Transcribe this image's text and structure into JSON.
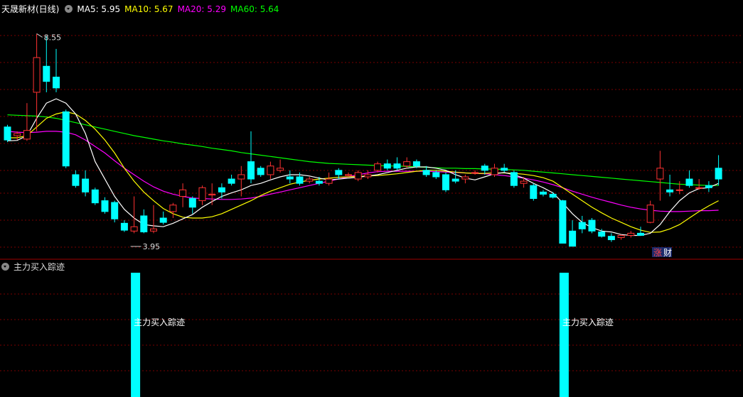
{
  "header": {
    "stock_title": "天晟新材(日线)",
    "ma5": "MA5: 5.95",
    "ma10": "MA10: 5.67",
    "ma20": "MA20: 5.29",
    "ma60": "MA60: 5.64"
  },
  "sub_panel": {
    "title": "主力买入踪迹",
    "bar_label": "主力买入踪迹"
  },
  "badges": {
    "zhang": "涨",
    "cai": "财"
  },
  "colors": {
    "up": "#ff3232",
    "down": "#00ffff",
    "ma5": "#ffffff",
    "ma10": "#ffff00",
    "ma20": "#ff00ff",
    "ma60": "#00ff00",
    "grid": "#7a0000",
    "signal": "#00ffff"
  },
  "chart_data": {
    "type": "candlestick",
    "high_label": "8.55",
    "low_label": "3.95",
    "ylim": [
      3.76,
      9.0
    ],
    "candles": [
      [
        6.4,
        6.45,
        6.05,
        6.1
      ],
      [
        6.2,
        6.3,
        6.1,
        6.25
      ],
      [
        6.12,
        6.95,
        6.08,
        6.32
      ],
      [
        7.2,
        8.55,
        6.3,
        8.0
      ],
      [
        7.8,
        8.5,
        7.2,
        7.45
      ],
      [
        7.55,
        8.2,
        7.2,
        7.3
      ],
      [
        6.75,
        6.8,
        5.45,
        5.5
      ],
      [
        5.3,
        5.4,
        5.0,
        5.05
      ],
      [
        5.2,
        5.4,
        4.8,
        4.9
      ],
      [
        4.95,
        5.0,
        4.6,
        4.65
      ],
      [
        4.7,
        4.78,
        4.4,
        4.45
      ],
      [
        4.66,
        4.7,
        4.2,
        4.28
      ],
      [
        4.18,
        4.25,
        3.98,
        4.02
      ],
      [
        4.0,
        4.8,
        3.95,
        4.1
      ],
      [
        4.35,
        4.5,
        3.95,
        3.98
      ],
      [
        4.0,
        4.6,
        3.95,
        4.05
      ],
      [
        4.3,
        4.45,
        4.15,
        4.2
      ],
      [
        4.45,
        4.65,
        4.3,
        4.6
      ],
      [
        4.8,
        5.1,
        4.55,
        4.95
      ],
      [
        4.75,
        4.8,
        4.4,
        4.55
      ],
      [
        4.7,
        5.05,
        4.6,
        5.0
      ],
      [
        4.83,
        5.1,
        4.6,
        4.85
      ],
      [
        5.0,
        5.1,
        4.75,
        4.9
      ],
      [
        5.2,
        5.3,
        5.05,
        5.1
      ],
      [
        5.2,
        5.5,
        4.8,
        5.3
      ],
      [
        5.6,
        6.3,
        5.1,
        5.2
      ],
      [
        5.45,
        5.5,
        5.25,
        5.3
      ],
      [
        5.3,
        5.6,
        5.2,
        5.5
      ],
      [
        5.4,
        5.65,
        5.35,
        5.45
      ],
      [
        5.25,
        5.4,
        5.1,
        5.2
      ],
      [
        5.25,
        5.35,
        5.05,
        5.1
      ],
      [
        5.15,
        5.25,
        5.1,
        5.2
      ],
      [
        5.15,
        5.25,
        5.05,
        5.1
      ],
      [
        5.1,
        5.35,
        5.05,
        5.2
      ],
      [
        5.4,
        5.45,
        5.2,
        5.3
      ],
      [
        5.3,
        5.35,
        5.25,
        5.3
      ],
      [
        5.2,
        5.4,
        5.15,
        5.35
      ],
      [
        5.25,
        5.4,
        5.2,
        5.3
      ],
      [
        5.4,
        5.6,
        5.35,
        5.55
      ],
      [
        5.55,
        5.65,
        5.4,
        5.45
      ],
      [
        5.55,
        5.7,
        5.4,
        5.45
      ],
      [
        5.5,
        5.7,
        5.45,
        5.6
      ],
      [
        5.6,
        5.65,
        5.45,
        5.5
      ],
      [
        5.4,
        5.5,
        5.25,
        5.3
      ],
      [
        5.35,
        5.4,
        5.2,
        5.25
      ],
      [
        5.3,
        5.35,
        4.9,
        4.95
      ],
      [
        5.2,
        5.4,
        5.1,
        5.15
      ],
      [
        5.2,
        5.3,
        5.1,
        5.25
      ],
      [
        5.35,
        5.4,
        5.3,
        5.35
      ],
      [
        5.5,
        5.55,
        5.3,
        5.4
      ],
      [
        5.3,
        5.55,
        5.25,
        5.45
      ],
      [
        5.45,
        5.55,
        5.35,
        5.4
      ],
      [
        5.35,
        5.4,
        5.0,
        5.05
      ],
      [
        5.1,
        5.25,
        5.0,
        5.15
      ],
      [
        5.05,
        5.1,
        4.7,
        4.75
      ],
      [
        4.9,
        4.95,
        4.8,
        4.85
      ],
      [
        4.85,
        4.9,
        4.75,
        4.78
      ],
      [
        4.7,
        4.72,
        3.75,
        3.72
      ],
      [
        4.0,
        4.25,
        3.65,
        3.65
      ],
      [
        4.2,
        4.35,
        3.95,
        4.05
      ],
      [
        4.25,
        4.3,
        3.95,
        4.0
      ],
      [
        3.98,
        4.05,
        3.85,
        3.88
      ],
      [
        3.88,
        3.95,
        3.75,
        3.8
      ],
      [
        3.85,
        3.92,
        3.8,
        3.9
      ],
      [
        3.9,
        4.0,
        3.85,
        3.95
      ],
      [
        3.95,
        4.1,
        3.9,
        3.9
      ],
      [
        4.2,
        4.7,
        4.18,
        4.6
      ],
      [
        5.2,
        5.85,
        4.7,
        5.45
      ],
      [
        4.95,
        5.3,
        4.8,
        4.9
      ],
      [
        4.95,
        5.15,
        4.85,
        4.95
      ],
      [
        5.2,
        5.4,
        5.0,
        5.05
      ],
      [
        5.0,
        5.2,
        4.95,
        5.0
      ],
      [
        5.05,
        5.15,
        4.9,
        5.0
      ],
      [
        5.45,
        5.75,
        5.05,
        5.2
      ]
    ],
    "ma5": [
      6.08,
      6.09,
      6.2,
      6.6,
      6.95,
      7.05,
      6.95,
      6.7,
      6.25,
      5.6,
      5.2,
      4.8,
      4.5,
      4.3,
      4.15,
      4.12,
      4.1,
      4.18,
      4.28,
      4.38,
      4.55,
      4.68,
      4.8,
      4.88,
      4.95,
      5.05,
      5.1,
      5.18,
      5.25,
      5.3,
      5.3,
      5.27,
      5.22,
      5.18,
      5.2,
      5.22,
      5.24,
      5.27,
      5.3,
      5.35,
      5.4,
      5.45,
      5.48,
      5.48,
      5.45,
      5.4,
      5.3,
      5.22,
      5.18,
      5.25,
      5.32,
      5.35,
      5.3,
      5.22,
      5.1,
      5.0,
      4.88,
      4.65,
      4.4,
      4.2,
      4.08,
      4.0,
      3.98,
      3.92,
      3.9,
      3.9,
      3.95,
      4.15,
      4.45,
      4.7,
      4.88,
      4.98,
      5.0,
      5.1
    ],
    "ma10": [
      6.15,
      6.15,
      6.2,
      6.4,
      6.6,
      6.7,
      6.75,
      6.7,
      6.55,
      6.35,
      6.1,
      5.8,
      5.45,
      5.15,
      4.9,
      4.7,
      4.52,
      4.4,
      4.32,
      4.3,
      4.3,
      4.33,
      4.4,
      4.5,
      4.6,
      4.7,
      4.82,
      4.92,
      5.0,
      5.08,
      5.13,
      5.17,
      5.2,
      5.22,
      5.24,
      5.25,
      5.26,
      5.27,
      5.28,
      5.3,
      5.32,
      5.35,
      5.38,
      5.4,
      5.4,
      5.38,
      5.36,
      5.34,
      5.33,
      5.33,
      5.34,
      5.34,
      5.33,
      5.31,
      5.28,
      5.23,
      5.15,
      5.0,
      4.85,
      4.7,
      4.55,
      4.42,
      4.3,
      4.2,
      4.1,
      4.02,
      3.97,
      3.98,
      4.05,
      4.15,
      4.3,
      4.45,
      4.58,
      4.7
    ],
    "ma20": [
      6.3,
      6.28,
      6.27,
      6.28,
      6.3,
      6.3,
      6.28,
      6.22,
      6.1,
      5.95,
      5.8,
      5.62,
      5.45,
      5.3,
      5.15,
      5.02,
      4.92,
      4.85,
      4.8,
      4.76,
      4.75,
      4.74,
      4.73,
      4.73,
      4.74,
      4.76,
      4.8,
      4.85,
      4.9,
      4.95,
      5.0,
      5.05,
      5.1,
      5.15,
      5.2,
      5.25,
      5.3,
      5.34,
      5.37,
      5.38,
      5.38,
      5.38,
      5.38,
      5.38,
      5.37,
      5.36,
      5.35,
      5.34,
      5.33,
      5.32,
      5.3,
      5.28,
      5.25,
      5.22,
      5.18,
      5.13,
      5.07,
      5.0,
      4.92,
      4.85,
      4.78,
      4.72,
      4.66,
      4.6,
      4.55,
      4.51,
      4.48,
      4.46,
      4.45,
      4.45,
      4.46,
      4.47,
      4.47,
      4.48
    ],
    "ma60": [
      6.68,
      6.67,
      6.66,
      6.65,
      6.63,
      6.6,
      6.55,
      6.5,
      6.45,
      6.4,
      6.35,
      6.3,
      6.25,
      6.2,
      6.16,
      6.12,
      6.08,
      6.05,
      6.01,
      5.98,
      5.95,
      5.91,
      5.88,
      5.85,
      5.81,
      5.78,
      5.75,
      5.72,
      5.69,
      5.66,
      5.63,
      5.6,
      5.58,
      5.56,
      5.55,
      5.54,
      5.53,
      5.52,
      5.51,
      5.5,
      5.5,
      5.49,
      5.48,
      5.47,
      5.46,
      5.45,
      5.45,
      5.44,
      5.44,
      5.43,
      5.43,
      5.42,
      5.41,
      5.4,
      5.38,
      5.36,
      5.34,
      5.32,
      5.3,
      5.28,
      5.26,
      5.24,
      5.22,
      5.2,
      5.18,
      5.16,
      5.14,
      5.12,
      5.1,
      5.08,
      5.07,
      5.06,
      5.05,
      5.05
    ],
    "signal_indices": [
      13,
      57
    ]
  }
}
